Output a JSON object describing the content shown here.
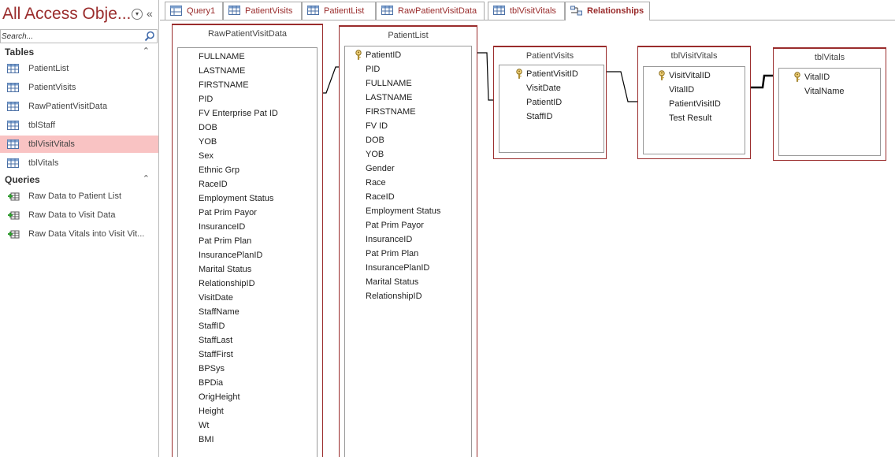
{
  "nav": {
    "title": "All Access Obje...",
    "search_placeholder": "Search...",
    "groups": {
      "tables": {
        "label": "Tables",
        "items": [
          "PatientList",
          "PatientVisits",
          "RawPatientVisitData",
          "tblStaff",
          "tblVisitVitals",
          "tblVitals"
        ],
        "selected": "tblVisitVitals"
      },
      "queries": {
        "label": "Queries",
        "items": [
          "Raw Data to Patient List",
          "Raw Data to Visit Data",
          "Raw Data Vitals into Visit Vit..."
        ]
      }
    }
  },
  "tabs": [
    {
      "label": "Query1",
      "icon": "query-icon"
    },
    {
      "label": "PatientVisits",
      "icon": "table-icon"
    },
    {
      "label": "PatientList",
      "icon": "table-icon"
    },
    {
      "label": "RawPatientVisitData",
      "icon": "table-icon"
    },
    {
      "label": "tblVisitVitals",
      "icon": "table-icon"
    },
    {
      "label": "Relationships",
      "icon": "relationships-icon",
      "active": true
    }
  ],
  "tables": {
    "raw": {
      "name": "RawPatientVisitData",
      "fields": [
        "FULLNAME",
        "LASTNAME",
        "FIRSTNAME",
        "PID",
        "FV Enterprise Pat ID",
        "DOB",
        "YOB",
        "Sex",
        "Ethnic Grp",
        "RaceID",
        "Employment Status",
        "Pat Prim Payor",
        "InsuranceID",
        "Pat Prim Plan",
        "InsurancePlanID",
        "Marital Status",
        "RelationshipID",
        "VisitDate",
        "StaffName",
        "StaffID",
        "StaffLast",
        "StaffFirst",
        "BPSys",
        "BPDia",
        "OrigHeight",
        "Height",
        "Wt",
        "BMI"
      ],
      "keys": []
    },
    "patientlist": {
      "name": "PatientList",
      "fields": [
        "PatientID",
        "PID",
        "FULLNAME",
        "LASTNAME",
        "FIRSTNAME",
        "FV ID",
        "DOB",
        "YOB",
        "Gender",
        "Race",
        "RaceID",
        "Employment Status",
        "Pat Prim Payor",
        "InsuranceID",
        "Pat Prim Plan",
        "InsurancePlanID",
        "Marital Status",
        "RelationshipID"
      ],
      "keys": [
        "PatientID"
      ]
    },
    "patientvisits": {
      "name": "PatientVisits",
      "fields": [
        "PatientVisitID",
        "VisitDate",
        "PatientID",
        "StaffID"
      ],
      "keys": [
        "PatientVisitID"
      ]
    },
    "tblvisitvitals": {
      "name": "tblVisitVitals",
      "fields": [
        "VisitVitalID",
        "VitalID",
        "PatientVisitID",
        "Test Result"
      ],
      "keys": [
        "VisitVitalID"
      ]
    },
    "tblvitals": {
      "name": "tblVitals",
      "fields": [
        "VitalID",
        "VitalName"
      ],
      "keys": [
        "VitalID"
      ]
    }
  },
  "colors": {
    "accent": "#9a2c2c",
    "selected_bg": "#f9c3c3",
    "canvas_bg": "#ffffff"
  }
}
